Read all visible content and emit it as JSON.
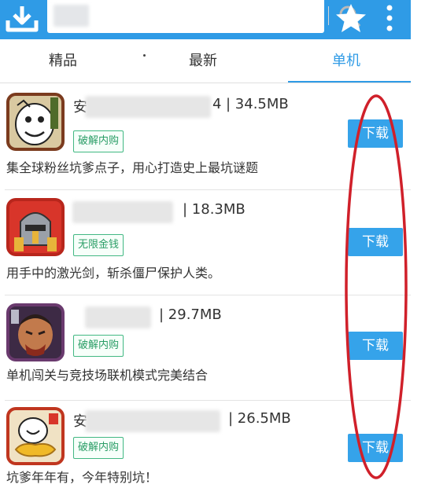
{
  "header": {
    "download_icon": "download-icon",
    "search": {
      "value": "",
      "placeholder": ""
    },
    "search_icon": "search-icon",
    "favorite_icon": "star-icon",
    "more_icon": "more-vertical-icon",
    "accent_color": "#2f9be6"
  },
  "tabs": [
    {
      "label": "精品",
      "active": false
    },
    {
      "label": "最新",
      "active": false
    },
    {
      "label": "单机",
      "active": true
    }
  ],
  "apps": [
    {
      "name_suffix": "4",
      "size": "34.5MB",
      "tag": "破解内购",
      "description": "集全球粉丝坑爹点子，用心打造史上最坑谜题",
      "button": "下载",
      "icon": "stickman-face-icon",
      "prefix": "安"
    },
    {
      "name_suffix": "",
      "size": "18.3MB",
      "tag": "无限金钱",
      "description": "用手中的激光剑，斩杀僵尸保护人类。",
      "button": "下载",
      "icon": "knight-helmet-icon",
      "prefix": ""
    },
    {
      "name_suffix": "",
      "size": "29.7MB",
      "tag": "破解内购",
      "description": "单机闯关与竞技场联机模式完美结合",
      "button": "下载",
      "icon": "warrior-face-icon",
      "prefix": ""
    },
    {
      "name_suffix": "",
      "size": "26.5MB",
      "tag": "破解内购",
      "description": "坑爹年年有，今年特别坑！",
      "button": "下载",
      "icon": "gold-ingot-face-icon",
      "prefix": "安"
    }
  ],
  "annotation": {
    "color": "#d0202a",
    "shape": "red-ellipse-highlight"
  }
}
